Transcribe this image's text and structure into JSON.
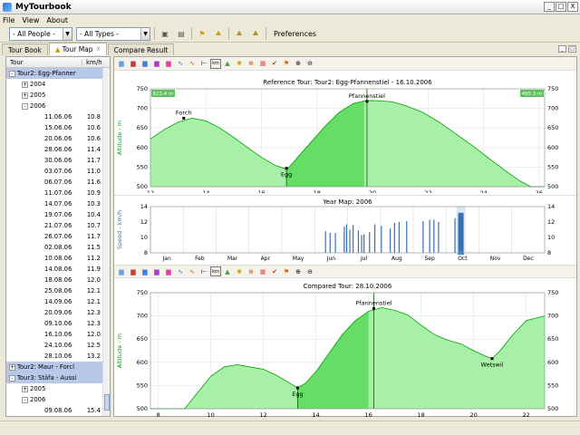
{
  "window": {
    "title": "MyTourbook",
    "minimize": "_",
    "maximize": "□",
    "close": "X"
  },
  "menu": [
    "File",
    "View",
    "About"
  ],
  "toolbar": {
    "people_select": "- All People -",
    "types_select": "- All Types -",
    "preferences": "Preferences"
  },
  "tabs": [
    {
      "label": "Tour Book",
      "active": false
    },
    {
      "label": "Tour Map",
      "active": true,
      "close": "X"
    },
    {
      "label": "Compare Result",
      "active": false
    }
  ],
  "tree": {
    "header_tour": "Tour",
    "header_speed": "km/h",
    "rows": [
      {
        "indent": 0,
        "expander": "-",
        "label": "Tour2: Egg-Pfanner",
        "kmh": "",
        "selected": true
      },
      {
        "indent": 1,
        "expander": "+",
        "label": "2004",
        "kmh": "",
        "selected": false
      },
      {
        "indent": 1,
        "expander": "+",
        "label": "2005",
        "kmh": "",
        "selected": false
      },
      {
        "indent": 1,
        "expander": "-",
        "label": "2006",
        "kmh": "",
        "selected": false
      },
      {
        "indent": 2,
        "expander": "",
        "label": "11.06.06",
        "kmh": "10.8",
        "selected": false
      },
      {
        "indent": 2,
        "expander": "",
        "label": "15.06.06",
        "kmh": "10.6",
        "selected": false
      },
      {
        "indent": 2,
        "expander": "",
        "label": "20.06.06",
        "kmh": "10.6",
        "selected": false
      },
      {
        "indent": 2,
        "expander": "",
        "label": "28.06.06",
        "kmh": "11.4",
        "selected": false
      },
      {
        "indent": 2,
        "expander": "",
        "label": "30.06.06",
        "kmh": "11.7",
        "selected": false
      },
      {
        "indent": 2,
        "expander": "",
        "label": "03.07.06",
        "kmh": "11.0",
        "selected": false
      },
      {
        "indent": 2,
        "expander": "",
        "label": "06.07.06",
        "kmh": "11.6",
        "selected": false
      },
      {
        "indent": 2,
        "expander": "",
        "label": "11.07.06",
        "kmh": "10.9",
        "selected": false
      },
      {
        "indent": 2,
        "expander": "",
        "label": "14.07.06",
        "kmh": "10.3",
        "selected": false
      },
      {
        "indent": 2,
        "expander": "",
        "label": "19.07.06",
        "kmh": "10.4",
        "selected": false
      },
      {
        "indent": 2,
        "expander": "",
        "label": "21.07.06",
        "kmh": "10.7",
        "selected": false
      },
      {
        "indent": 2,
        "expander": "",
        "label": "26.07.06",
        "kmh": "11.7",
        "selected": false
      },
      {
        "indent": 2,
        "expander": "",
        "label": "02.08.06",
        "kmh": "11.5",
        "selected": false
      },
      {
        "indent": 2,
        "expander": "",
        "label": "10.08.06",
        "kmh": "11.2",
        "selected": false
      },
      {
        "indent": 2,
        "expander": "",
        "label": "14.08.06",
        "kmh": "11.9",
        "selected": false
      },
      {
        "indent": 2,
        "expander": "",
        "label": "18.08.06",
        "kmh": "12.0",
        "selected": false
      },
      {
        "indent": 2,
        "expander": "",
        "label": "25.08.06",
        "kmh": "12.1",
        "selected": false
      },
      {
        "indent": 2,
        "expander": "",
        "label": "14.09.06",
        "kmh": "12.1",
        "selected": false
      },
      {
        "indent": 2,
        "expander": "",
        "label": "20.09.06",
        "kmh": "12.3",
        "selected": false
      },
      {
        "indent": 2,
        "expander": "",
        "label": "09.10.06",
        "kmh": "12.3",
        "selected": false
      },
      {
        "indent": 2,
        "expander": "",
        "label": "16.10.06",
        "kmh": "12.0",
        "selected": false
      },
      {
        "indent": 2,
        "expander": "",
        "label": "24.10.06",
        "kmh": "12.5",
        "selected": false
      },
      {
        "indent": 2,
        "expander": "",
        "label": "28.10.06",
        "kmh": "13.2",
        "selected": false
      },
      {
        "indent": 0,
        "expander": "+",
        "label": "Tour2: Maur - Forcl",
        "kmh": "",
        "selected": true
      },
      {
        "indent": 0,
        "expander": "-",
        "label": "Tour3: Stäfa - Aussi",
        "kmh": "",
        "selected": true
      },
      {
        "indent": 1,
        "expander": "+",
        "label": "2005",
        "kmh": "",
        "selected": false
      },
      {
        "indent": 1,
        "expander": "-",
        "label": "2006",
        "kmh": "",
        "selected": false
      },
      {
        "indent": 2,
        "expander": "",
        "label": "09.08.06",
        "kmh": "15.4",
        "selected": false
      }
    ]
  },
  "chart_data": [
    {
      "type": "area",
      "title": "Reference Tour: Tour2: Egg-Pfannenstiel - 16.10.2006",
      "ylabel": "Altitude - m",
      "x_ticks": [
        12,
        14,
        16,
        18,
        20,
        22,
        24,
        26
      ],
      "y_ticks": [
        500,
        550,
        600,
        650,
        700,
        750
      ],
      "xlim": [
        12,
        26.2
      ],
      "ylim": [
        500,
        750
      ],
      "left_badge": "623.4 m",
      "right_badge": "495.3 m",
      "x": [
        12.0,
        12.5,
        13.0,
        13.5,
        14.0,
        14.5,
        15.0,
        15.5,
        16.0,
        16.5,
        16.9,
        17.0,
        17.3,
        17.8,
        18.3,
        18.8,
        19.3,
        19.7,
        20.0,
        20.3,
        20.7,
        21.2,
        21.8,
        22.4,
        23.0,
        23.6,
        24.2,
        24.8,
        25.3,
        25.7,
        26.2
      ],
      "y": [
        622,
        646,
        665,
        675,
        668,
        650,
        626,
        600,
        575,
        554,
        545,
        550,
        575,
        615,
        655,
        690,
        712,
        719,
        720,
        719,
        717,
        707,
        690,
        665,
        635,
        605,
        572,
        540,
        515,
        498,
        495
      ],
      "annotations": [
        {
          "label": "Forch",
          "x": 13.2,
          "y": 675
        },
        {
          "label": "Egg",
          "x": 16.9,
          "y": 547
        },
        {
          "label": "Pfannenstiel",
          "x": 19.8,
          "y": 718
        }
      ],
      "highlight_range": [
        16.9,
        19.8
      ]
    },
    {
      "type": "bar",
      "title": "Year Map: 2006",
      "ylabel": "Speed - km/h",
      "months": [
        "Jan",
        "Feb",
        "Mar",
        "Apr",
        "May",
        "Jun",
        "Jul",
        "Aug",
        "Sep",
        "Oct",
        "Nov",
        "Dec"
      ],
      "y_ticks": [
        8,
        10,
        12,
        14
      ],
      "ylim": [
        8,
        14
      ],
      "x": [
        5.33,
        5.47,
        5.63,
        5.9,
        5.97,
        6.07,
        6.17,
        6.33,
        6.43,
        6.5,
        6.67,
        6.83,
        7.03,
        7.3,
        7.43,
        7.57,
        7.8,
        8.3,
        8.5,
        8.63,
        8.77,
        9.27,
        9.45
      ],
      "values": [
        10.8,
        10.6,
        10.6,
        11.4,
        11.7,
        11.0,
        11.6,
        10.9,
        10.3,
        10.4,
        10.7,
        11.7,
        11.5,
        11.2,
        11.9,
        12.0,
        12.1,
        12.1,
        12.3,
        12.3,
        12.0,
        12.5,
        13.2
      ],
      "selected_index": 22
    },
    {
      "type": "area",
      "title": "Compared Tour: 28.10.2006",
      "ylabel": "Altitude - m",
      "x_ticks": [
        8,
        10,
        12,
        14,
        16,
        18,
        20,
        22
      ],
      "y_ticks": [
        500,
        550,
        600,
        650,
        700,
        750
      ],
      "xlim": [
        7.7,
        22.7
      ],
      "ylim": [
        500,
        750
      ],
      "x": [
        7.7,
        9.0,
        9.5,
        10.0,
        10.5,
        11.0,
        11.5,
        12.0,
        12.5,
        13.0,
        13.3,
        13.6,
        14.0,
        14.5,
        15.0,
        15.5,
        16.0,
        16.5,
        17.0,
        17.5,
        18.0,
        18.5,
        19.0,
        19.5,
        20.0,
        20.5,
        20.7,
        21.0,
        21.5,
        22.0,
        22.7
      ],
      "y": [
        490,
        500,
        535,
        570,
        590,
        595,
        590,
        585,
        572,
        555,
        545,
        555,
        580,
        620,
        660,
        690,
        710,
        718,
        712,
        702,
        680,
        660,
        648,
        640,
        625,
        612,
        608,
        625,
        660,
        690,
        700
      ],
      "annotations": [
        {
          "label": "Egg",
          "x": 13.3,
          "y": 545
        },
        {
          "label": "Pfannenstiel",
          "x": 16.2,
          "y": 716
        },
        {
          "label": "Wetswil",
          "x": 20.7,
          "y": 608
        }
      ],
      "highlight_range": [
        13.3,
        16.2
      ]
    }
  ],
  "colors": {
    "fill": "#a8f0a8",
    "fill_strong": "#66dd66",
    "line": "#00a000",
    "bar": "#3a6fb0",
    "selected": "#dbe6f5"
  }
}
